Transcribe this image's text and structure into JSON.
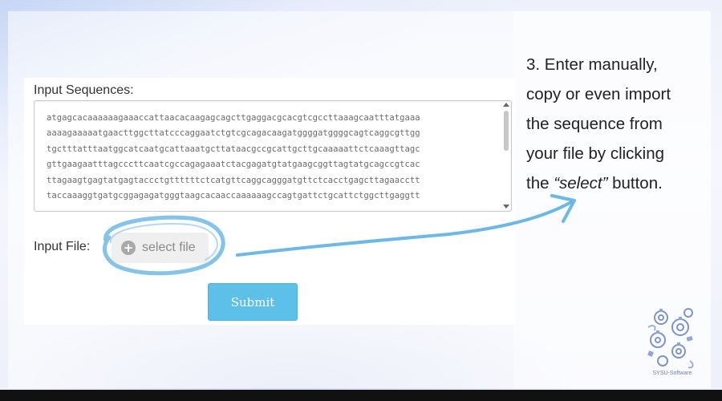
{
  "form": {
    "sequences_label": "Input Sequences:",
    "sequence_lines": [
      "atgagcacaaaaaagaaaccattaacacaagagcagcttgaggacgcacgtcgccttaaagcaatttatgaaa",
      "aaaagaaaaatgaacttggcttatcccaggaatctgtcgcagacaagatggggatggggcagtcaggcgttgg",
      "tgctttatttaatggcatcaatgcattaaatgcttataacgccgcattgcttgcaaaaattctcaaagttagc",
      "gttgaagaatttagcccttcaatcgccagagaaatctacgagatgtatgaagcggttagtatgcagccgtcac",
      "ttagaagtgagtatgagtaccctgttttttctcatgttcaggcagggatgttctcacctgagcttagaacctt",
      "taccaaaggtgatgcggagagatgggtaagcacaaccaaaaaagccagtgattctgcattctggcttgaggtt"
    ],
    "file_label": "Input File:",
    "select_file_label": "select file",
    "submit_label": "Submit"
  },
  "instruction": {
    "line1": "3. Enter manually,",
    "line2": "copy or even import",
    "line3": "the sequence from",
    "line4": "your file by clicking",
    "line5_prefix": "the ",
    "line5_emphasis": "“select”",
    "line5_suffix": " button."
  },
  "logo": {
    "text": "SYSU-Software"
  },
  "icons": {
    "select_file": "plus-circle-icon",
    "logo": "gear-cluster-logo-icon"
  },
  "colors": {
    "accent_blue": "#5cc0e8",
    "annotation_blue": "#4aa3d8"
  }
}
